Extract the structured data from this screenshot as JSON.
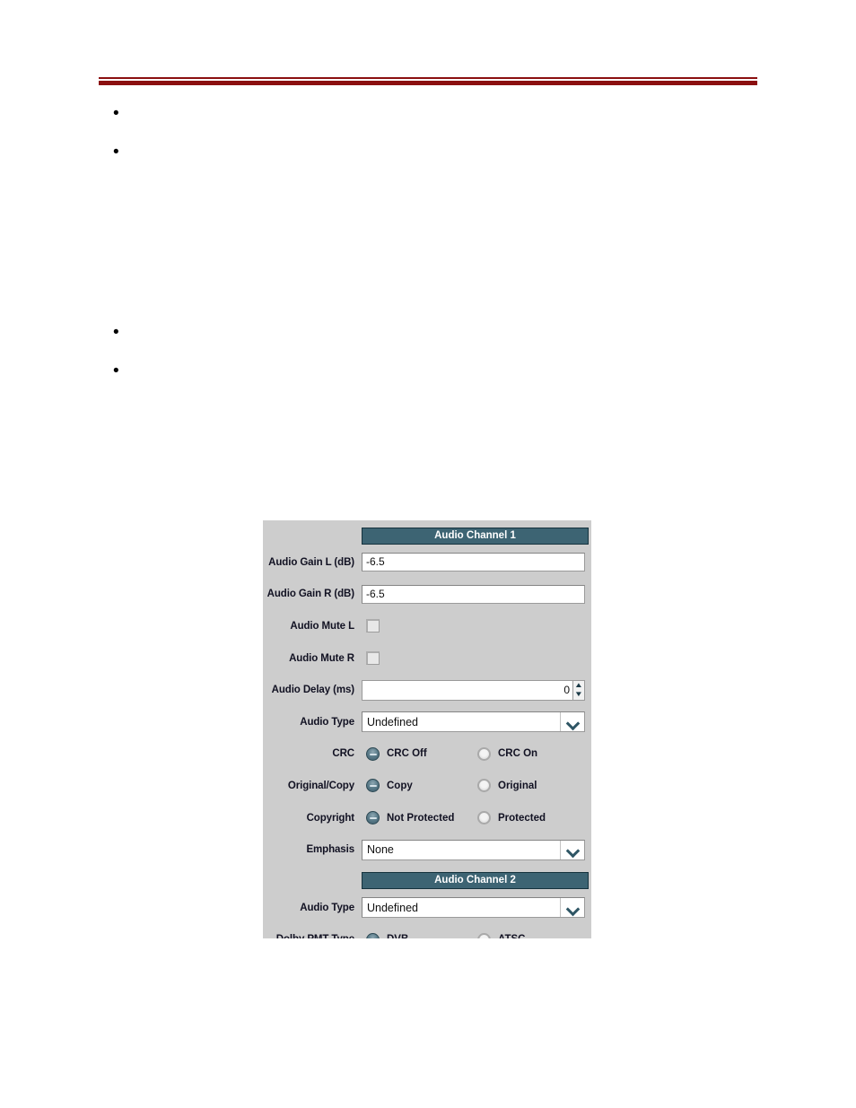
{
  "page": {
    "header_rule_color": "#8b0f10"
  },
  "bullets": {
    "group_1": [
      {
        "text": ""
      },
      {
        "text": ""
      }
    ],
    "group_2": [
      {
        "text": ""
      },
      {
        "text": ""
      }
    ]
  },
  "panel": {
    "background_color": "#cdcdcd",
    "section_header_color": "#3d6473",
    "sections": [
      {
        "title": "Audio Channel 1",
        "rows": [
          {
            "label": "Audio Gain L (dB)",
            "type": "text",
            "value": "-6.5"
          },
          {
            "label": "Audio Gain R (dB)",
            "type": "text",
            "value": "-6.5"
          },
          {
            "label": "Audio Mute L",
            "type": "checkbox",
            "checked": false
          },
          {
            "label": "Audio Mute R",
            "type": "checkbox",
            "checked": false
          },
          {
            "label": "Audio Delay (ms)",
            "type": "spinner",
            "value": "0"
          },
          {
            "label": "Audio Type",
            "type": "select",
            "value": "Undefined"
          },
          {
            "label": "CRC",
            "type": "radio",
            "options": [
              {
                "label": "CRC Off",
                "selected": true
              },
              {
                "label": "CRC On",
                "selected": false
              }
            ]
          },
          {
            "label": "Original/Copy",
            "type": "radio",
            "options": [
              {
                "label": "Copy",
                "selected": true
              },
              {
                "label": "Original",
                "selected": false
              }
            ]
          },
          {
            "label": "Copyright",
            "type": "radio",
            "options": [
              {
                "label": "Not Protected",
                "selected": true
              },
              {
                "label": "Protected",
                "selected": false
              }
            ]
          },
          {
            "label": "Emphasis",
            "type": "select",
            "value": "None"
          }
        ]
      },
      {
        "title": "Audio Channel 2",
        "rows": [
          {
            "label": "Audio Type",
            "type": "select",
            "value": "Undefined"
          },
          {
            "label": "Dolby PMT Type",
            "type": "radio",
            "options": [
              {
                "label": "DVB",
                "selected": true
              },
              {
                "label": "ATSC",
                "selected": false
              }
            ]
          }
        ]
      }
    ]
  }
}
